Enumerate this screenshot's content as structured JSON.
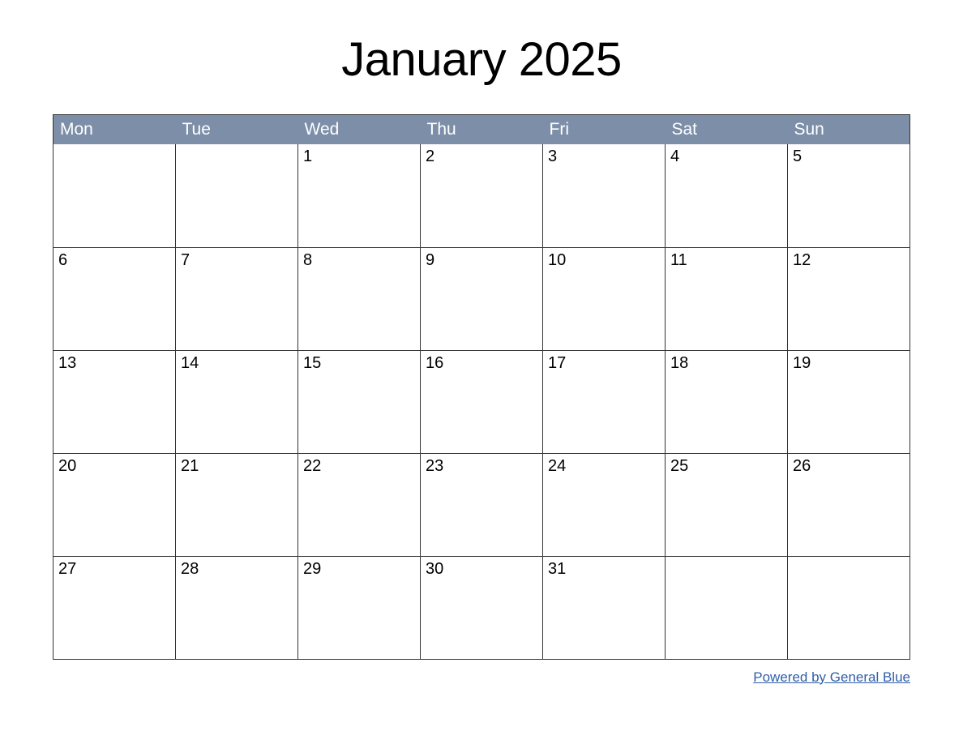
{
  "title": "January 2025",
  "weekdays": [
    "Mon",
    "Tue",
    "Wed",
    "Thu",
    "Fri",
    "Sat",
    "Sun"
  ],
  "weeks": [
    [
      "",
      "",
      "1",
      "2",
      "3",
      "4",
      "5"
    ],
    [
      "6",
      "7",
      "8",
      "9",
      "10",
      "11",
      "12"
    ],
    [
      "13",
      "14",
      "15",
      "16",
      "17",
      "18",
      "19"
    ],
    [
      "20",
      "21",
      "22",
      "23",
      "24",
      "25",
      "26"
    ],
    [
      "27",
      "28",
      "29",
      "30",
      "31",
      "",
      ""
    ]
  ],
  "footer": {
    "link_text": "Powered by General Blue"
  }
}
